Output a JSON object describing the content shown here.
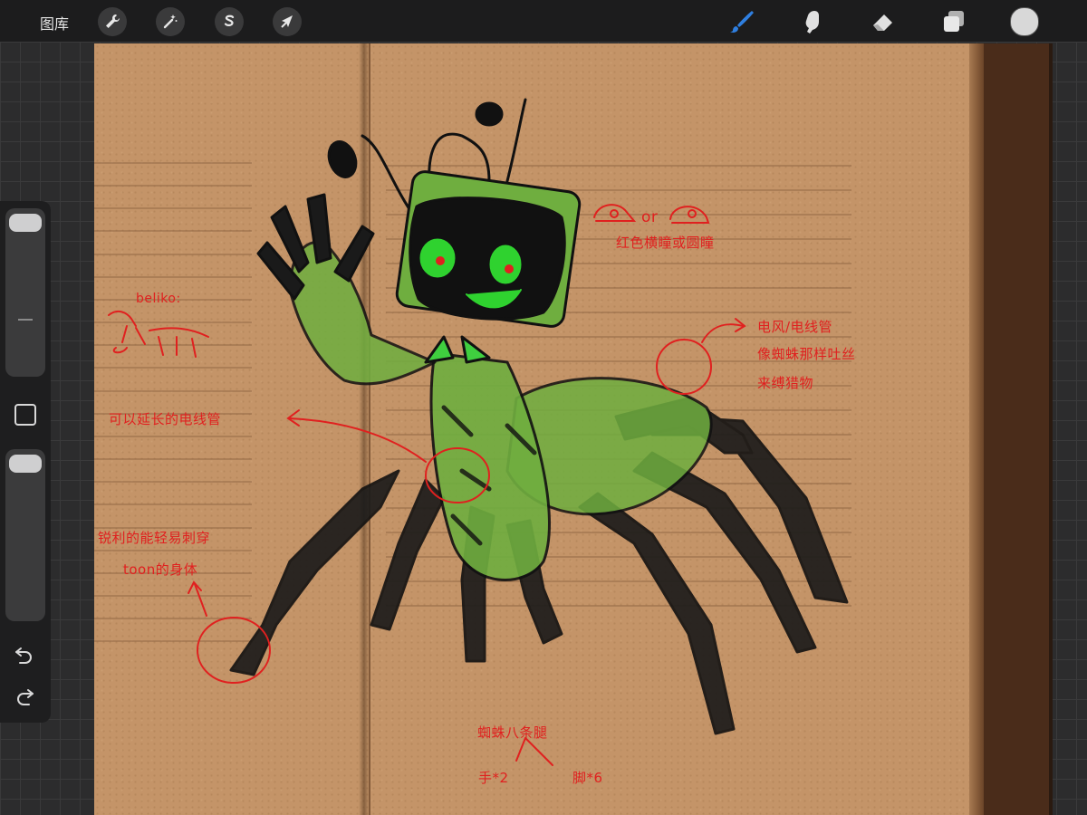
{
  "app": {
    "gallery_label": "图库",
    "tools_left": [
      {
        "name": "actions",
        "icon": "wrench-icon"
      },
      {
        "name": "adjustments",
        "icon": "magic-wand-icon"
      },
      {
        "name": "selection",
        "icon": "selection-s-icon"
      },
      {
        "name": "transform",
        "icon": "arrow-cursor-icon"
      }
    ],
    "tools_right": [
      {
        "name": "brush",
        "icon": "brush-icon",
        "active": true
      },
      {
        "name": "smudge",
        "icon": "smudge-finger-icon"
      },
      {
        "name": "eraser",
        "icon": "eraser-icon"
      },
      {
        "name": "layers",
        "icon": "layers-icon"
      }
    ],
    "colors": {
      "toolbar": "#1c1c1d",
      "active_tool": "#2f7fe0",
      "current_color": "#d8d8d8",
      "ink_red": "#e0201f",
      "ink_black": "#111111",
      "marker_green": "#6fae3f",
      "paper": "#c49468"
    }
  },
  "sidebar": {
    "brush_size_level": 0.0,
    "opacity_level": 0.0,
    "modify_button_icon": "square-icon",
    "undo_icon": "undo-icon",
    "redo_icon": "redo-icon"
  },
  "notes": {
    "eyes_or": "or",
    "eyes_caption": "红色横瞳或圆瞳",
    "wire_line1": "电风/电线管",
    "wire_line2": "像蜘蛛那样吐丝",
    "wire_line3": "来缚猎物",
    "beliko": "beliko:",
    "extendable": "可以延长的电线管",
    "sharp_line1": "锐利的能轻易刺穿",
    "sharp_line2": "toon的身体",
    "legs_title": "蜘蛛八条腿",
    "hands": "手*2",
    "feet": "脚*6"
  }
}
